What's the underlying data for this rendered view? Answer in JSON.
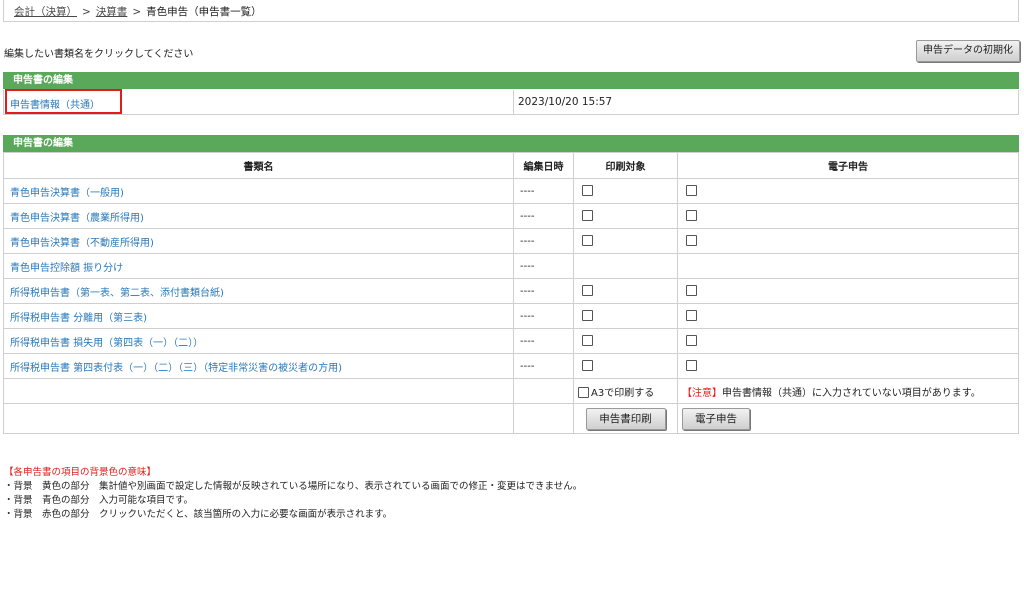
{
  "breadcrumb": {
    "item1": "会計（決算）",
    "sep": ">",
    "item2": "決算書",
    "current": "青色申告（申告書一覧）"
  },
  "instruction": "編集したい書類名をクリックしてください",
  "init_button": "申告データの初期化",
  "section1": {
    "header": "申告書の編集",
    "link": "申告書情報（共通）",
    "date": "2023/10/20 15:57"
  },
  "section2": {
    "header": "申告書の編集",
    "columns": [
      "書類名",
      "編集日時",
      "印刷対象",
      "電子申告"
    ],
    "rows": [
      {
        "name": "青色申告決算書（一般用)",
        "date": "----"
      },
      {
        "name": "青色申告決算書（農業所得用)",
        "date": "----"
      },
      {
        "name": "青色申告決算書（不動産所得用)",
        "date": "----"
      },
      {
        "name": "青色申告控除額 振り分け",
        "date": "----"
      },
      {
        "name": "所得税申告書（第一表、第二表、添付書類台紙)",
        "date": "----"
      },
      {
        "name": "所得税申告書 分離用（第三表)",
        "date": "----"
      },
      {
        "name": "所得税申告書 損失用（第四表（一）（二））",
        "date": "----"
      },
      {
        "name": "所得税申告書 第四表付表（一）（二）（三）（特定非常災害の被災者の方用)",
        "date": "----"
      }
    ],
    "a3_label": "A3で印刷する",
    "notice_tag": "【注意】",
    "notice_text": "申告書情報（共通）に入力されていない項目があります。",
    "print_button": "申告書印刷",
    "efile_button": "電子申告"
  },
  "legend": {
    "title": "【各申告書の項目の背景色の意味】",
    "lines": [
      "・背景　黄色の部分　集計値や別画面で設定した情報が反映されている場所になり、表示されている画面での修正・変更はできません。",
      "・背景　青色の部分　入力可能な項目です。",
      "・背景　赤色の部分　クリックいただくと、該当箇所の入力に必要な画面が表示されます。"
    ]
  }
}
